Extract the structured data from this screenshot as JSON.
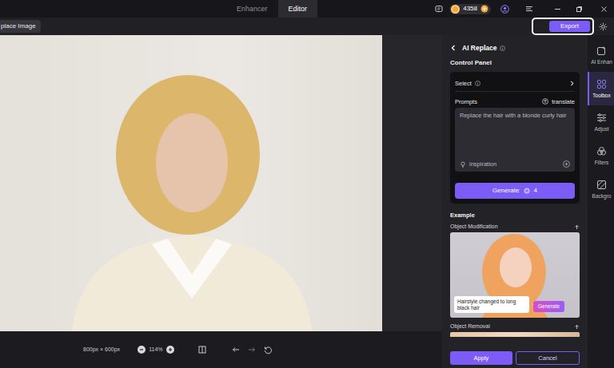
{
  "window": {
    "tabs": [
      {
        "label": "Enhancer",
        "selected": false
      },
      {
        "label": "Editor",
        "selected": true
      }
    ],
    "credits": "4358"
  },
  "toolbar": {
    "replace_button": "place Image",
    "export_button": "Export",
    "export_highlighted": true
  },
  "canvas": {
    "size": "800px × 600px",
    "zoom": "114%"
  },
  "panel": {
    "title": "AI Replace",
    "section": "Control Panel",
    "select_label": "Select",
    "prompts_label": "Prompts",
    "translate": "translate",
    "prompt": "Replace the hair with a blonde curly hair",
    "inspiration": "inspiration",
    "generate": {
      "label": "Generate",
      "cost": "4"
    },
    "example_title": "Example",
    "examples": [
      {
        "title": "Object Modification",
        "caption": "Hairstyle changed to long black hair",
        "button": "Generate"
      },
      {
        "title": "Object Removal"
      }
    ],
    "apply": "Apply",
    "cancel": "Cancel"
  },
  "sidebar": {
    "items": [
      {
        "label": "AI Enhan",
        "selected": false
      },
      {
        "label": "Toolbox",
        "selected": true
      },
      {
        "label": "Adjust",
        "selected": false
      },
      {
        "label": "Filters",
        "selected": false
      },
      {
        "label": "Backgro",
        "selected": false
      }
    ]
  }
}
